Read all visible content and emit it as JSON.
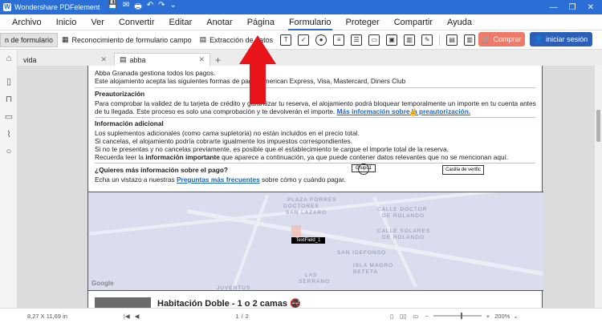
{
  "app": {
    "title": "Wondershare PDFelement"
  },
  "titlebar_controls": [
    "—",
    "❐",
    "✕"
  ],
  "quick_access": [
    "💾",
    "✉",
    "🖶",
    "↶",
    "↷",
    "⌄"
  ],
  "menu": {
    "items": [
      "Archivo",
      "Inicio",
      "Ver",
      "Convertir",
      "Editar",
      "Anotar",
      "Página",
      "Formulario",
      "Proteger",
      "Compartir",
      "Ayuda"
    ],
    "active_index": 7
  },
  "toolbar": {
    "form_button": "n de formulario",
    "recognition": "Reconocimiento de formulario campo",
    "extraction": "Extracción de datos",
    "buy": "Comprar",
    "login": "iniciar sesión"
  },
  "tabs": [
    {
      "label": "vida",
      "active": false
    },
    {
      "label": "abba",
      "active": true
    }
  ],
  "document": {
    "line1": "Abba Granada gestiona todos los pagos.",
    "line2": "Este alojamiento acepta las siguientes formas de pago: American Express, Visa, Mastercard, Diners Club",
    "pre_heading": "Preautorización",
    "pre_1": "Para comprobar la validez de tu tarjeta de crédito y garantizar tu reserva, el alojamiento podrá bloquear temporalmente un importe en tu cuenta antes",
    "pre_2": "de tu llegada. Este proceso es solo una comprobación y te devolverán el importe.",
    "pre_link": "Más información sobre la preautorización.",
    "info_heading": "Información adicional",
    "info_1": "Los suplementos adicionales (como cama supletoria) no están incluidos en el precio total.",
    "info_2": "Si cancelas, el alojamiento podría cobrarte igualmente los impuestos correspondientes.",
    "info_3": "Si no te presentas y no cancelas previamente, es posible que el establecimiento te cargue el importe total de la reserva.",
    "info_4a": "Recuerda leer la ",
    "info_4b": "información importante",
    "info_4c": " que aparece a continuación, ya que puede contener datos relevantes que no se mencionan aquí.",
    "payment_heading": "¿Quieres más información sobre el pago?",
    "payment_a": "Echa un vistazo a nuestras ",
    "payment_link": "Preguntas más frecuentes",
    "payment_b": " sobre cómo y cuándo pagar.",
    "field_group": "Grupo1",
    "field_checkbox": "Casilla de verific",
    "field_text": "TextField_1",
    "room_title": "Habitación Doble - 1 o 2 camas"
  },
  "map": {
    "streets": [
      "PLAZA PORRES",
      "DOCTORES",
      "SAN LAZARO",
      "CALLE DOCTOR",
      "DE ROLANDO",
      "CALLE SOLARES",
      "DE ROLANDO",
      "SAN IDEFONSO",
      "ISLA MAGRO",
      "BETETA",
      "LAS",
      "SERRANO",
      "JUVENTUS"
    ],
    "google": "Google"
  },
  "statusbar": {
    "page_size": "8,27 X 11,69 in",
    "page_num": "1",
    "page_total": "2",
    "zoom": "200%"
  }
}
